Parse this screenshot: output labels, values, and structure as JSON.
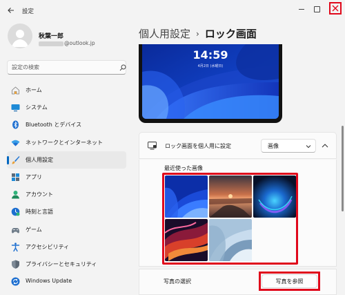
{
  "window": {
    "title": "設定"
  },
  "profile": {
    "name": "秋葉一郎",
    "email_suffix": "@outlook.jp"
  },
  "search": {
    "placeholder": "設定の検索"
  },
  "nav": {
    "items": [
      {
        "label": "ホーム",
        "icon": "home-icon"
      },
      {
        "label": "システム",
        "icon": "system-icon"
      },
      {
        "label": "Bluetooth とデバイス",
        "icon": "bluetooth-icon"
      },
      {
        "label": "ネットワークとインターネット",
        "icon": "wifi-icon"
      },
      {
        "label": "個人用設定",
        "icon": "brush-icon",
        "active": true
      },
      {
        "label": "アプリ",
        "icon": "apps-icon"
      },
      {
        "label": "アカウント",
        "icon": "account-icon"
      },
      {
        "label": "時刻と言語",
        "icon": "time-language-icon"
      },
      {
        "label": "ゲーム",
        "icon": "gamepad-icon"
      },
      {
        "label": "アクセシビリティ",
        "icon": "accessibility-icon"
      },
      {
        "label": "プライバシーとセキュリティ",
        "icon": "shield-icon"
      },
      {
        "label": "Windows Update",
        "icon": "windows-update-icon"
      }
    ]
  },
  "breadcrumb": {
    "parent": "個人用設定",
    "separator": "›",
    "current": "ロック画面"
  },
  "preview": {
    "time": "14:59",
    "date": "4月2日 (水曜日)"
  },
  "lock_screen": {
    "label": "ロック画面を個人用に設定",
    "selected": "画像",
    "recent_label": "最近使った画像",
    "recent_images": [
      "blue-bloom-wallpaper",
      "sunset-wallpaper",
      "blue-orb-wallpaper",
      "red-swirl-wallpaper",
      "light-blue-bloom-wallpaper"
    ],
    "browse_label": "写真の選択",
    "browse_button": "写真を参照"
  },
  "colors": {
    "accent": "#0067c0",
    "highlight": "#e0081b"
  }
}
